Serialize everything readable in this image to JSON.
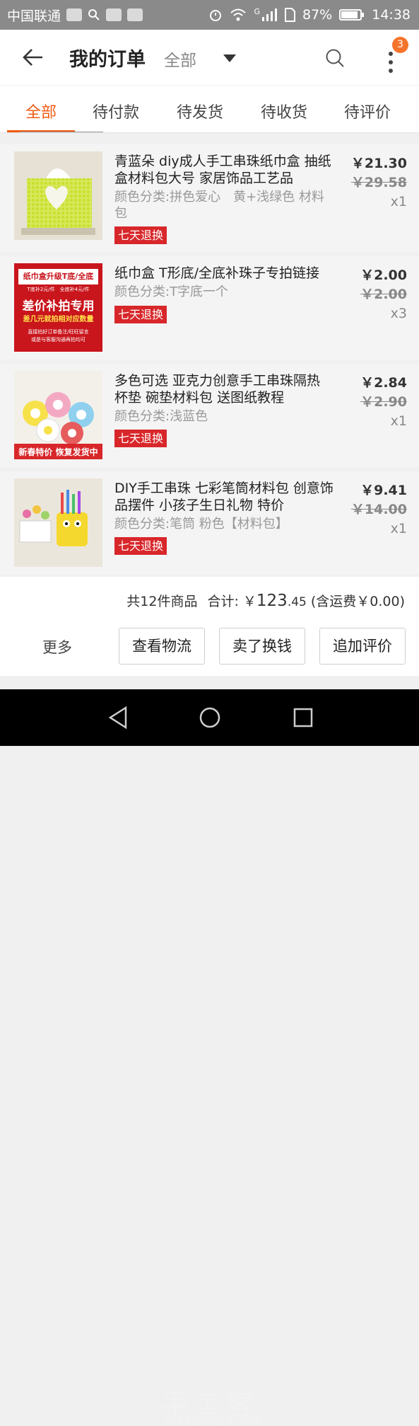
{
  "status_bar": {
    "carrier": "中国联通",
    "battery": "87%",
    "time": "14:38",
    "signal_label": "G"
  },
  "header": {
    "title": "我的订单",
    "filter": "全部",
    "notification_count": "3"
  },
  "tabs": [
    {
      "label": "全部",
      "active": true
    },
    {
      "label": "待付款",
      "active": false
    },
    {
      "label": "待发货",
      "active": false
    },
    {
      "label": "待收货",
      "active": false
    },
    {
      "label": "待评价",
      "active": false
    }
  ],
  "items": [
    {
      "title": "青蓝朵 diy成人手工串珠纸巾盒 抽纸盒材料包大号 家居饰品工艺品",
      "spec": "颜色分类:拼色爱心　黄+浅绿色 材料包",
      "tag": "七天退换",
      "price": "￥21.30",
      "original_price": "￥29.58",
      "qty": "x1"
    },
    {
      "title": "纸巾盒 T形底/全底补珠子专拍链接",
      "spec": "颜色分类:T字底一个",
      "tag": "七天退换",
      "price": "￥2.00",
      "original_price": "￥2.00",
      "qty": "x3",
      "thumb_text": {
        "line1": "纸巾盒升级T底/全底",
        "line2": "T底补2元/件　全底补4元/件",
        "line3": "差价补拍专用",
        "line4": "差几元就拍相对应数量",
        "line5": "直接拍好订单备注/旺旺留言",
        "line6": "或是与客服沟通再拍均可"
      }
    },
    {
      "title": "多色可选 亚克力创意手工串珠隔热杯垫 碗垫材料包 送图纸教程",
      "spec": "颜色分类:浅蓝色",
      "tag": "七天退换",
      "price": "￥2.84",
      "original_price": "￥2.90",
      "qty": "x1",
      "thumb_text": {
        "banner": "新春特价 恢复发货中"
      }
    },
    {
      "title": "DIY手工串珠 七彩笔筒材料包 创意饰品摆件 小孩子生日礼物 特价",
      "spec": "颜色分类:笔筒 粉色【材料包】",
      "tag": "七天退换",
      "price": "￥9.41",
      "original_price": "￥14.00",
      "qty": "x1"
    }
  ],
  "summary": {
    "count": "共12件商品",
    "total_label": "合计:",
    "total_currency": "￥",
    "total_int": "123",
    "total_dec": ".45",
    "shipping": "(含运费￥0.00)"
  },
  "actions": {
    "more": "更多",
    "logistics": "查看物流",
    "resell": "卖了换钱",
    "add_review": "追加评价"
  },
  "watermark": {
    "text": "手工客",
    "url": "shougongke.com"
  },
  "colors": {
    "accent": "#f25a13",
    "tag_red": "#d8272a",
    "badge": "#f5742b"
  }
}
